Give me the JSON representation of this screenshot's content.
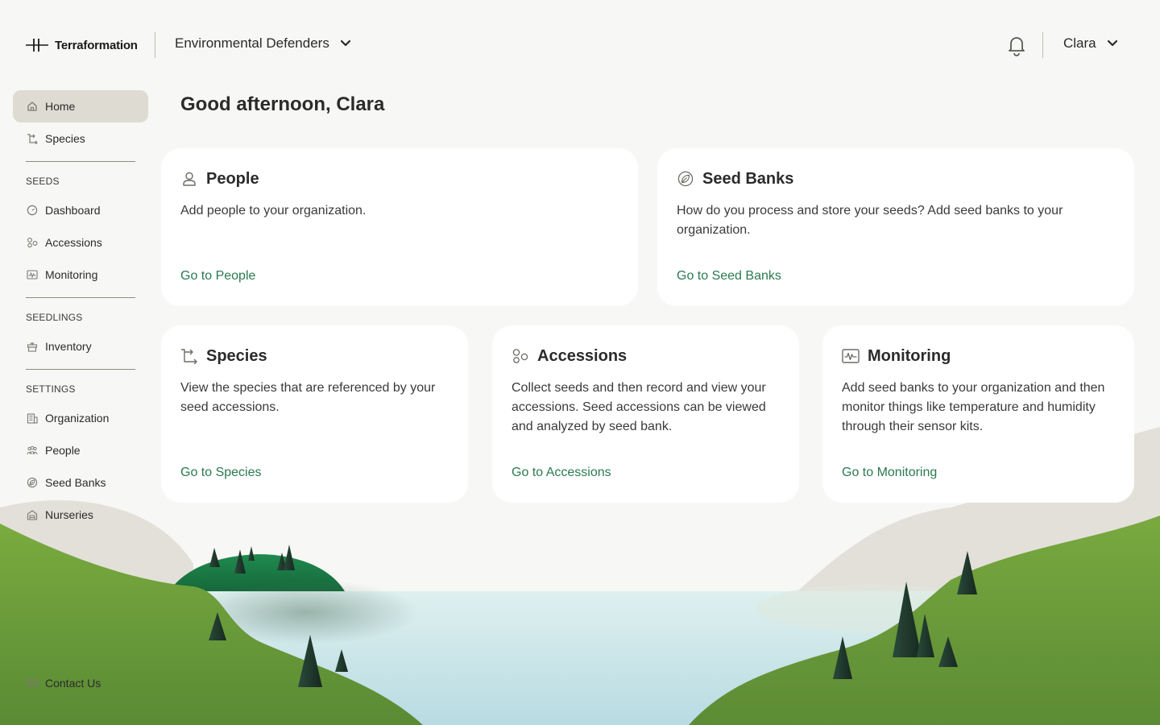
{
  "header": {
    "logo_text": "Terraformation",
    "organization": "Environmental Defenders",
    "user_name": "Clara"
  },
  "sidebar": {
    "top_items": [
      {
        "label": "Home",
        "icon": "home-icon",
        "active": true
      },
      {
        "label": "Species",
        "icon": "species-icon"
      }
    ],
    "sections": [
      {
        "heading": "SEEDS",
        "items": [
          {
            "label": "Dashboard",
            "icon": "dashboard-icon"
          },
          {
            "label": "Accessions",
            "icon": "accessions-icon"
          },
          {
            "label": "Monitoring",
            "icon": "monitoring-icon"
          }
        ]
      },
      {
        "heading": "SEEDLINGS",
        "items": [
          {
            "label": "Inventory",
            "icon": "inventory-icon"
          }
        ]
      },
      {
        "heading": "SETTINGS",
        "items": [
          {
            "label": "Organization",
            "icon": "organization-icon"
          },
          {
            "label": "People",
            "icon": "people-icon"
          },
          {
            "label": "Seed Banks",
            "icon": "seed-bank-icon"
          },
          {
            "label": "Nurseries",
            "icon": "nursery-icon"
          }
        ]
      }
    ],
    "contact": {
      "label": "Contact Us",
      "icon": "mail-icon"
    }
  },
  "main": {
    "greeting": "Good afternoon, Clara",
    "cards": [
      {
        "title": "People",
        "icon": "person-icon",
        "description": "Add people to your organization.",
        "link": "Go to People"
      },
      {
        "title": "Seed Banks",
        "icon": "seed-bank-icon",
        "description": "How do you process and store your seeds? Add seed banks to your organization.",
        "link": "Go to Seed Banks"
      },
      {
        "title": "Species",
        "icon": "species-icon",
        "description": "View the species that are referenced by your seed accessions.",
        "link": "Go to Species"
      },
      {
        "title": "Accessions",
        "icon": "accessions-icon",
        "description": "Collect seeds and then record and view your accessions. Seed accessions can be viewed and analyzed by seed bank.",
        "link": "Go to Accessions"
      },
      {
        "title": "Monitoring",
        "icon": "monitoring-icon",
        "description": "Add seed banks to your organization and then monitor things like temperature and humidity through their sensor kits.",
        "link": "Go to Monitoring"
      }
    ]
  },
  "colors": {
    "background": "#f7f7f5",
    "active_nav": "#dedbd2",
    "link_green": "#2b7a51",
    "hill_green": "#6e9e3c",
    "water": "#cfe8ea"
  }
}
